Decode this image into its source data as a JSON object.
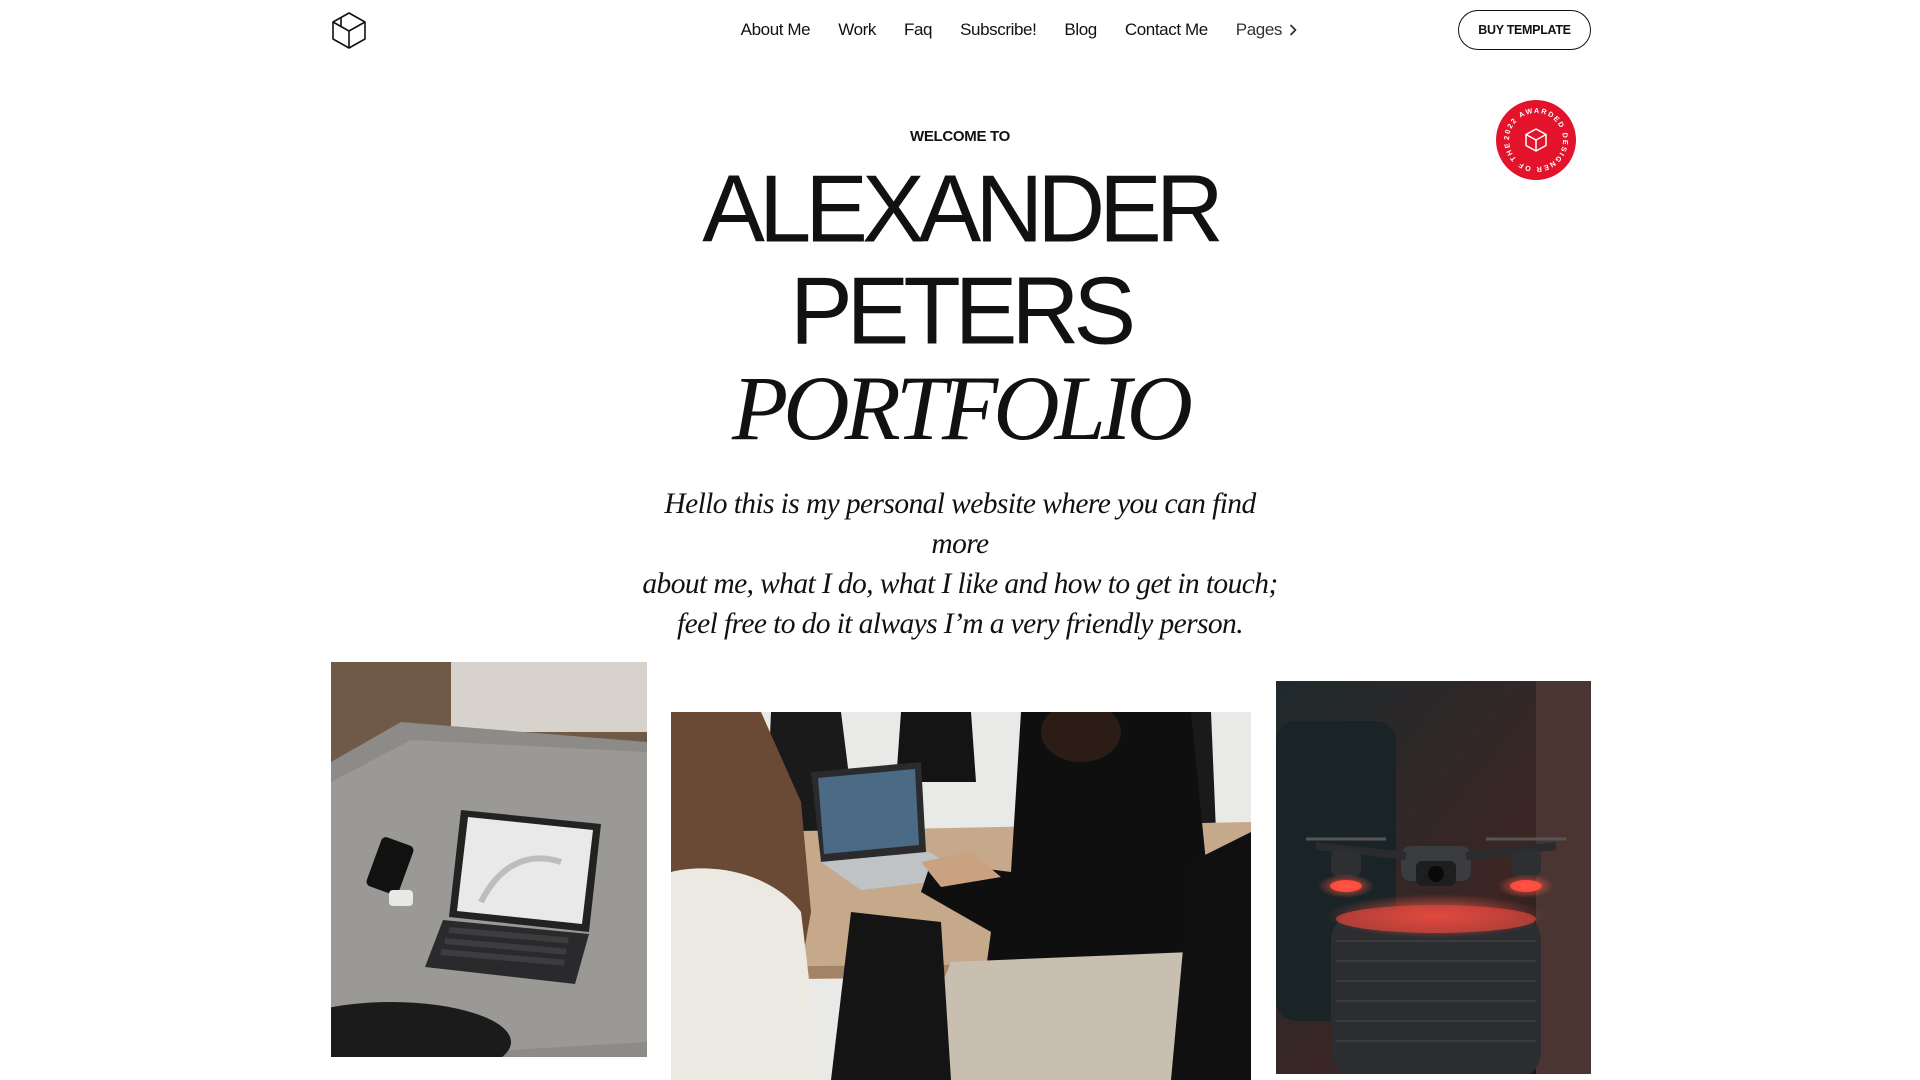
{
  "header": {
    "logo_icon": "cube-logo-icon",
    "nav": {
      "about": "About Me",
      "work": "Work",
      "faq": "Faq",
      "subscribe": "Subscribe!",
      "blog": "Blog",
      "contact": "Contact Me",
      "pages": "Pages"
    },
    "pages_icon": "chevron-right-icon",
    "buy_button": "BUY TEMPLATE"
  },
  "badge": {
    "text": "2022 AWARDED DESIGNER OF THE YEAR",
    "icon": "cube-icon",
    "color": "#e3132c"
  },
  "hero": {
    "welcome": "WELCOME TO",
    "name_line_1": "ALEXANDER",
    "name_line_2": "PETERS",
    "portfolio": "PORTFOLIO",
    "intro_line_1": "Hello this is my personal website where you can find more",
    "intro_line_2": "about me, what I do, what I like and how to get in touch;",
    "intro_line_3": "feel free to do it always I’m a very friendly person."
  },
  "gallery": {
    "photo_1": "tablet-with-keyboard-on-table-photo",
    "photo_2": "person-working-on-laptop-photo",
    "photo_3": "drone-with-red-lights-photo"
  }
}
